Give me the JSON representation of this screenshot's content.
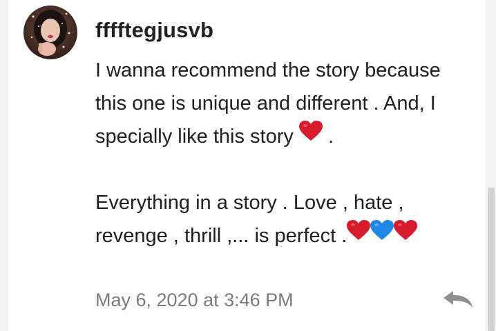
{
  "comment": {
    "author": "fffftegjusvb",
    "paragraph_1_text": "I wanna recommend the story because this one is unique and different . And, I specially like this story",
    "paragraph_1_end": " .",
    "paragraph_2_text": "Everything in a story . Love , hate , revenge , thrill ,... is perfect .",
    "timestamp": "May 6, 2020 at 3:46 PM",
    "avatar_icon": "user-avatar",
    "reply_icon": "reply-arrow-icon",
    "heart_colors": {
      "red": "#d81b2c",
      "blue": "#1e88e5"
    }
  }
}
